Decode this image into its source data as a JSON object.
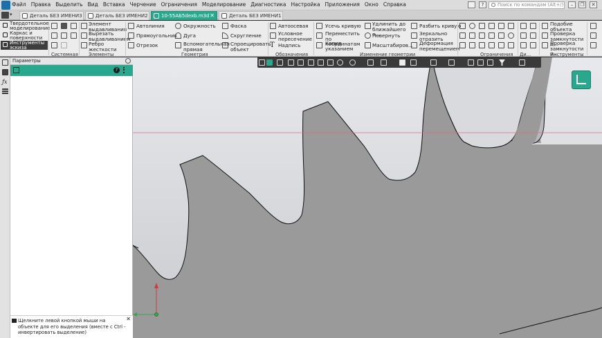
{
  "menu": [
    "Файл",
    "Правка",
    "Выделить",
    "Вид",
    "Вставка",
    "Черчение",
    "Ограничения",
    "Моделирование",
    "Диагностика",
    "Настройка",
    "Приложения",
    "Окно",
    "Справка"
  ],
  "search": {
    "placeholder": "Поиск по командам (Alt+/)"
  },
  "window_buttons": {
    "minimize": "–",
    "restore": "❐",
    "close": "✕"
  },
  "tabs": [
    {
      "label": "Деталь БЕЗ ИМЕНИ3",
      "active": false
    },
    {
      "label": "Деталь БЕЗ ИМЕНИ2",
      "active": false
    },
    {
      "label": "10-55АБ5dexb.m3d",
      "active": true
    },
    {
      "label": "Деталь БЕЗ ИМЕНИ1",
      "active": false
    }
  ],
  "modes": [
    {
      "label": "Твердотельное моделирование",
      "active": false
    },
    {
      "label": "Каркас и поверхности",
      "active": false
    },
    {
      "label": "Инструменты эскиза",
      "active": true
    }
  ],
  "ribbon": {
    "elements": [
      "Элемент выдавливания",
      "Вырезать выдавливанием",
      "Ребро жесткости"
    ],
    "geometry_col1": [
      "Автолиния",
      "Прямоугольник",
      "Отрезок"
    ],
    "geometry_col2": [
      "Окружность",
      "Дуга",
      "Вспомогательная прямая"
    ],
    "geometry_col3": [
      "Фаска",
      "Скругление",
      "Спроецировать объект"
    ],
    "designations": [
      "Автоосевая",
      "Условное пересечение",
      "Надпись"
    ],
    "edit_col1": [
      "Усечь кривую",
      "Переместить по координатам",
      "Копия указанием"
    ],
    "edit_col2": [
      "Удлинить до ближайшего о...",
      "Повернуть",
      "Масштабиров..."
    ],
    "edit_col3": [
      "Разбить кривую",
      "Зеркально отразить",
      "Деформация перемещением"
    ],
    "tools": [
      "Подобие объекта",
      "Проверка замкнутости д...",
      "Проверка замкнутости о..."
    ],
    "groups": [
      "Системная",
      "Элементы",
      "Геометрия",
      "Обозначения",
      "Изменение геометрии",
      "Ограничения",
      "Ди...",
      "Инструменты"
    ]
  },
  "panel": {
    "title": "Параметры",
    "hint": "Щелкните левой кнопкой мыши на объекте для его выделения (вместе с Ctrl - инвертировать выделение)"
  },
  "colors": {
    "accent": "#2aa88e",
    "menubar": "#dcdcdc",
    "ribbon": "#ececec",
    "dark_toolbar": "#3a3a3a",
    "sketch_fill": "#9a9a9a",
    "axis_x": "#3aa64a",
    "axis_y": "#d43a3a",
    "guide_line": "#e06a7a"
  },
  "icons": [
    "app-logo-icon",
    "home-icon",
    "sketch-mode-icon",
    "tree-icon",
    "function-icon",
    "list-icon",
    "help-icon",
    "pin-icon",
    "gear-icon",
    "filter-icon"
  ]
}
